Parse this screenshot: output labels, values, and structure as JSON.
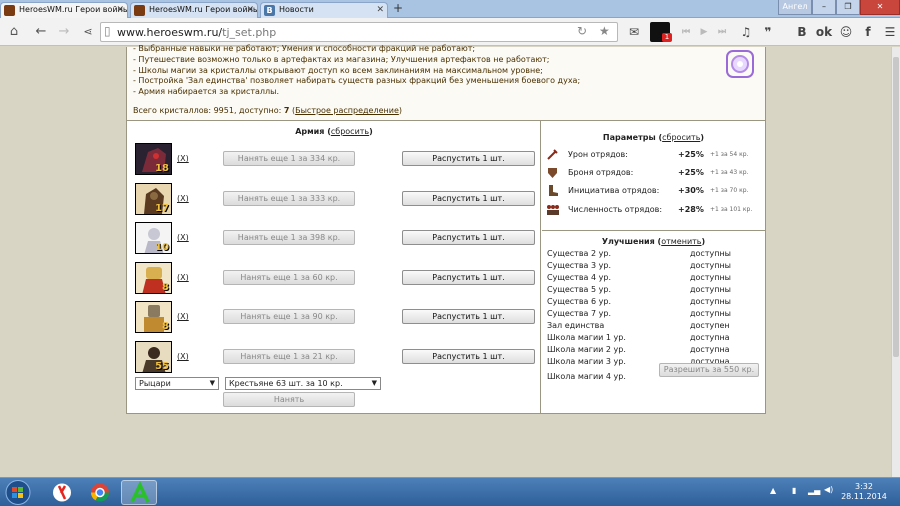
{
  "browser": {
    "tabs": [
      {
        "title": "HeroesWM.ru Герои войны"
      },
      {
        "title": "HeroesWM.ru Герои войны"
      },
      {
        "title": "Новости"
      }
    ],
    "user": "Ангел",
    "url_host": "www.heroeswm.ru/",
    "url_path": "tj_set.php",
    "badge": "1"
  },
  "info": {
    "lines": [
      "- Выбранные навыки не работают; Умения и способности фракций не работают;",
      "- Путешествие возможно только в артефактах из магазина; Улучшения артефактов не работают;",
      "- Школы магии за кристаллы открывают доступ ко всем заклинаниям на максимальном уровне;",
      "- Постройка 'Зал единства' позволяет набирать существ разных фракций без уменьшения боевого духа;",
      "- Армия набирается за кристаллы."
    ],
    "total_label": "Всего кристаллов: 9951, доступно:",
    "available": "7",
    "quick_link": "Быстрое распределение"
  },
  "army": {
    "title": "Армия",
    "reset_link": "сбросить",
    "remove_label": "(X)",
    "dismiss_label": "Распустить 1 шт.",
    "units": [
      {
        "count": "18",
        "hire": "Нанять еще 1 за 334 кр."
      },
      {
        "count": "17",
        "hire": "Нанять еще 1 за 333 кр."
      },
      {
        "count": "10",
        "hire": "Нанять еще 1 за 398 кр."
      },
      {
        "count": "8",
        "hire": "Нанять еще 1 за 60 кр."
      },
      {
        "count": "8",
        "hire": "Нанять еще 1 за 90 кр."
      },
      {
        "count": "55",
        "hire": "Нанять еще 1 за 21 кр."
      }
    ],
    "faction_select": "Рыцари",
    "unit_select": "Крестьяне 63 шт. за 10 кр.",
    "hire_button": "Нанять"
  },
  "params": {
    "title": "Параметры",
    "reset_link": "сбросить",
    "rows": [
      {
        "label": "Урон отрядов:",
        "value": "+25%",
        "cost": "+1 за 54 кр."
      },
      {
        "label": "Броня отрядов:",
        "value": "+25%",
        "cost": "+1 за 43 кр."
      },
      {
        "label": "Инициатива отрядов:",
        "value": "+30%",
        "cost": "+1 за 70 кр."
      },
      {
        "label": "Численность отрядов:",
        "value": "+28%",
        "cost": "+1 за 101 кр."
      }
    ]
  },
  "upgrades": {
    "title": "Улучшения",
    "cancel_link": "отменить",
    "rows": [
      {
        "name": "Существа 2 ур.",
        "status": "доступны"
      },
      {
        "name": "Существа 3 ур.",
        "status": "доступны"
      },
      {
        "name": "Существа 4 ур.",
        "status": "доступны"
      },
      {
        "name": "Существа 5 ур.",
        "status": "доступны"
      },
      {
        "name": "Существа 6 ур.",
        "status": "доступны"
      },
      {
        "name": "Существа 7 ур.",
        "status": "доступны"
      },
      {
        "name": "Зал единства",
        "status": "доступен"
      },
      {
        "name": "Школа магии 1 ур.",
        "status": "доступна"
      },
      {
        "name": "Школа магии 2 ур.",
        "status": "доступна"
      },
      {
        "name": "Школа магии 3 ур.",
        "status": "доступна"
      }
    ],
    "last_name": "Школа магии 4 ур.",
    "allow_button": "Разрешить за 550 кр."
  },
  "taskbar": {
    "time": "3:32",
    "date": "28.11.2014"
  }
}
